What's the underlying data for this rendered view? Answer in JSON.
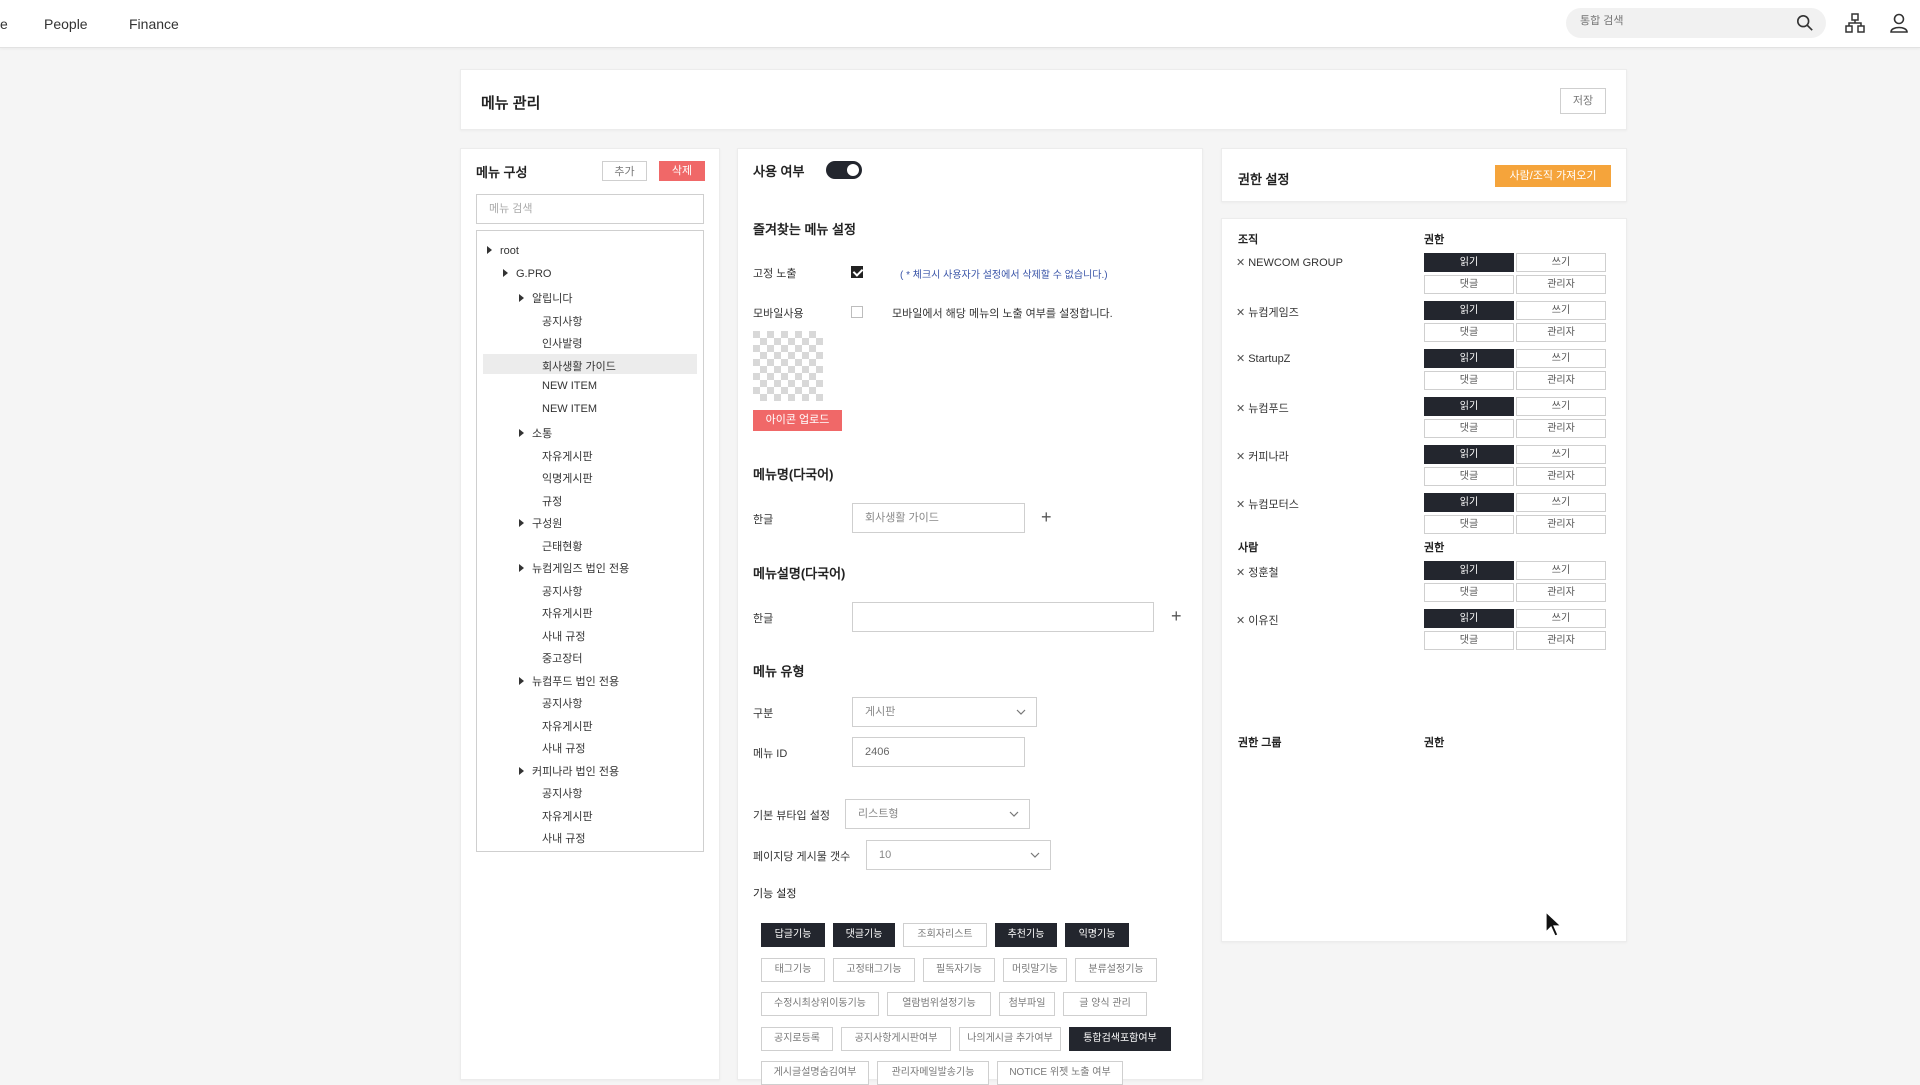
{
  "nav": {
    "partial": "e",
    "people": "People",
    "finance": "Finance",
    "search_placeholder": "통합 검색"
  },
  "header": {
    "title": "메뉴 관리",
    "save_label": "저장"
  },
  "menu_tree": {
    "title": "메뉴 구성",
    "add_label": "추가",
    "delete_label": "삭제",
    "search_placeholder": "메뉴 검색",
    "items": [
      {
        "label": "root",
        "depth": 0,
        "arrow": true
      },
      {
        "label": "G.PRO",
        "depth": 1,
        "arrow": true
      },
      {
        "label": "알립니다",
        "depth": 2,
        "arrow": true
      },
      {
        "label": "공지사항",
        "depth": 3,
        "arrow": false
      },
      {
        "label": "인사발령",
        "depth": 3,
        "arrow": false
      },
      {
        "label": "회사생활 가이드",
        "depth": 3,
        "arrow": false,
        "selected": true
      },
      {
        "label": "NEW ITEM",
        "depth": 3,
        "arrow": false
      },
      {
        "label": "NEW ITEM",
        "depth": 3,
        "arrow": false
      },
      {
        "label": "소통",
        "depth": 2,
        "arrow": true
      },
      {
        "label": "자유게시판",
        "depth": 3,
        "arrow": false
      },
      {
        "label": "익명게시판",
        "depth": 3,
        "arrow": false
      },
      {
        "label": "규정",
        "depth": 3,
        "arrow": false
      },
      {
        "label": "구성원",
        "depth": 2,
        "arrow": true
      },
      {
        "label": "근태현황",
        "depth": 3,
        "arrow": false
      },
      {
        "label": "뉴컴게임즈 법인 전용",
        "depth": 2,
        "arrow": true
      },
      {
        "label": "공지사항",
        "depth": 3,
        "arrow": false
      },
      {
        "label": "자유게시판",
        "depth": 3,
        "arrow": false
      },
      {
        "label": "사내 규정",
        "depth": 3,
        "arrow": false
      },
      {
        "label": "중고장터",
        "depth": 3,
        "arrow": false
      },
      {
        "label": "뉴컴푸드 법인 전용",
        "depth": 2,
        "arrow": true
      },
      {
        "label": "공지사항",
        "depth": 3,
        "arrow": false
      },
      {
        "label": "자유게시판",
        "depth": 3,
        "arrow": false
      },
      {
        "label": "사내 규정",
        "depth": 3,
        "arrow": false
      },
      {
        "label": "커피나라 법인 전용",
        "depth": 2,
        "arrow": true
      },
      {
        "label": "공지사항",
        "depth": 3,
        "arrow": false
      },
      {
        "label": "자유게시판",
        "depth": 3,
        "arrow": false
      },
      {
        "label": "사내 규정",
        "depth": 3,
        "arrow": false
      }
    ]
  },
  "settings": {
    "use_label": "사용 여부",
    "use_enabled": true,
    "favorites_title": "즐겨찾는 메뉴 설정",
    "fixed_label": "고정 노출",
    "fixed_checked": true,
    "fixed_note": "( * 체크시 사용자가 설정에서 삭제할 수 없습니다.)",
    "mobile_label": "모바일사용",
    "mobile_checked": false,
    "mobile_note": "모바일에서 해당 메뉴의 노출 여부를 설정합니다.",
    "icon_upload_label": "아이콘 업로드",
    "menu_name_title": "메뉴명(다국어)",
    "korean_label": "한글",
    "menu_name_value": "회사생활 가이드",
    "menu_desc_title": "메뉴설명(다국어)",
    "korean_label2": "한글",
    "menu_desc_value": "",
    "menu_type_title": "메뉴 유형",
    "category_label": "구분",
    "category_value": "게시판",
    "menu_id_label": "메뉴 ID",
    "menu_id_value": "2406",
    "view_type_label": "기본 뷰타입 설정",
    "view_type_value": "리스트형",
    "per_page_label": "페이지당 게시물 갯수",
    "per_page_value": "10",
    "feature_title": "기능 설정",
    "features": [
      [
        {
          "label": "답글기능",
          "on": true
        },
        {
          "label": "댓글기능",
          "on": true
        },
        {
          "label": "조회자리스트",
          "on": false
        },
        {
          "label": "추천기능",
          "on": true
        },
        {
          "label": "익명기능",
          "on": true
        }
      ],
      [
        {
          "label": "태그기능",
          "on": false
        },
        {
          "label": "고정태그기능",
          "on": false
        },
        {
          "label": "필독자기능",
          "on": false
        },
        {
          "label": "머릿말기능",
          "on": false
        },
        {
          "label": "분류설정기능",
          "on": false
        }
      ],
      [
        {
          "label": "수정시최상위이동기능",
          "on": false
        },
        {
          "label": "열람범위설정기능",
          "on": false
        },
        {
          "label": "첨부파일",
          "on": false
        },
        {
          "label": "글 양식 관리",
          "on": false
        }
      ],
      [
        {
          "label": "공지로등록",
          "on": false
        },
        {
          "label": "공지사항게시판여부",
          "on": false
        },
        {
          "label": "나의게시글 추가여부",
          "on": false
        },
        {
          "label": "통합검색포함여부",
          "on": true
        }
      ],
      [
        {
          "label": "게시글설명숨김여부",
          "on": false
        },
        {
          "label": "관리자메일발송기능",
          "on": false
        },
        {
          "label": "NOTICE 위젯 노출 여부",
          "on": false
        }
      ]
    ]
  },
  "permissions": {
    "title": "권한 설정",
    "import_label": "사람/조직 가져오기",
    "org_head": "조직",
    "perm_head": "권한",
    "orgs": [
      "NEWCOM GROUP",
      "뉴컴게임즈",
      "StartupZ",
      "뉴컴푸드",
      "커피나라",
      "뉴컴모터스"
    ],
    "people_head": "사람",
    "perm_head2": "권한",
    "people": [
      "정훈철",
      "이유진"
    ],
    "buttons": {
      "read": "읽기",
      "write": "쓰기",
      "comment": "댓글",
      "admin": "관리자"
    },
    "group_head": "권한 그룹",
    "perm_head3": "권한"
  }
}
